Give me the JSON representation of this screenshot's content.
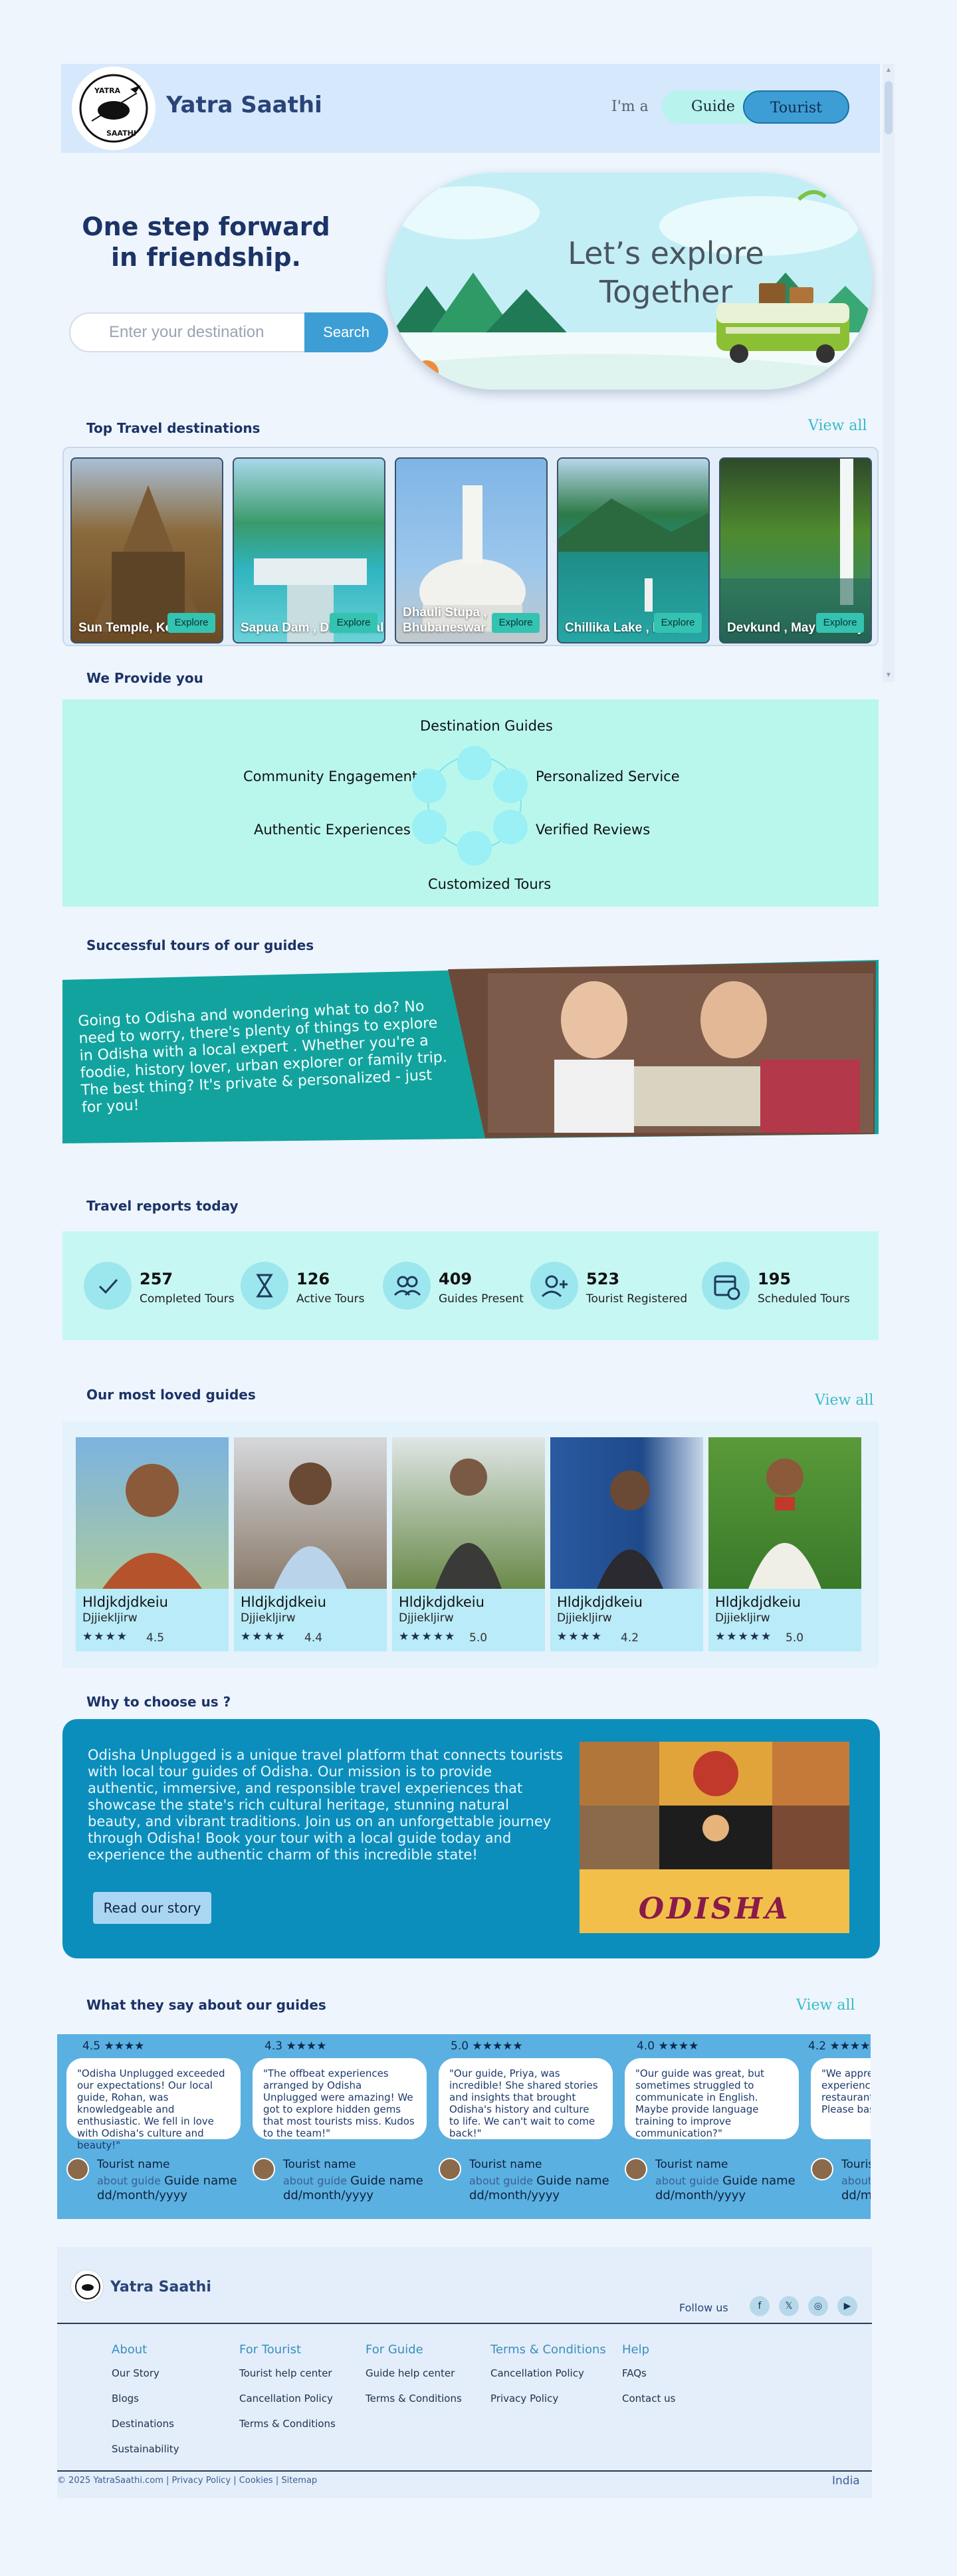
{
  "header": {
    "brand": "Yatra Saathi",
    "logo_text_top": "YATRA",
    "logo_text_bottom": "SAATHI",
    "role_prompt": "I'm a",
    "role_options": [
      "Guide",
      "Tourist"
    ],
    "selected_role": "Tourist"
  },
  "hero": {
    "title": "One step forward in friendship.",
    "search_placeholder": "Enter your destination",
    "search_button": "Search",
    "banner_text_line1": "Let’s explore",
    "banner_text_line2": "Together"
  },
  "destinations": {
    "heading": "Top Travel destinations",
    "view_all": "View all",
    "items": [
      {
        "name": "Sun Temple, Konark",
        "button": "Explore"
      },
      {
        "name": "Sapua Dam , Dhenkanal",
        "button": "Explore"
      },
      {
        "name": "Dhauli Stupa , Bhubaneswar",
        "button": "Explore"
      },
      {
        "name": "Chillika Lake , Puri",
        "button": "Explore"
      },
      {
        "name": "Devkund , Mayurbhanj",
        "button": "Explore"
      }
    ]
  },
  "provide": {
    "heading": "We Provide you",
    "items": [
      "Destination Guides",
      "Community Engagement",
      "Personalized Service",
      "Authentic Experiences",
      "Verified Reviews",
      "Customized Tours"
    ]
  },
  "tours": {
    "heading": "Successful tours of our guides",
    "text": "Going to Odisha and wondering what to do? No need to worry, there's plenty of things to explore in Odisha with a local expert . Whether you're a foodie, history lover, urban explorer or family trip. The best thing? It's private & personalized - just for you!"
  },
  "reports": {
    "heading": "Travel reports today",
    "stats": [
      {
        "value": "257",
        "label": "Completed Tours",
        "icon": "check-icon"
      },
      {
        "value": "126",
        "label": "Active Tours",
        "icon": "hourglass-icon"
      },
      {
        "value": "409",
        "label": "Guides Present",
        "icon": "users-icon"
      },
      {
        "value": "523",
        "label": "Tourist Registered",
        "icon": "user-add-icon"
      },
      {
        "value": "195",
        "label": "Scheduled Tours",
        "icon": "calendar-icon"
      }
    ]
  },
  "guides": {
    "heading": "Our most loved guides",
    "view_all": "View all",
    "items": [
      {
        "name": "Hldjkdjdkeiu",
        "sub": "Djjiekljirw",
        "stars": "★★★★",
        "rating": "4.5"
      },
      {
        "name": "Hldjkdjdkeiu",
        "sub": "Djjiekljirw",
        "stars": "★★★★",
        "rating": "4.4"
      },
      {
        "name": "Hldjkdjdkeiu",
        "sub": "Djjiekljirw",
        "stars": "★★★★★",
        "rating": "5.0"
      },
      {
        "name": "Hldjkdjdkeiu",
        "sub": "Djjiekljirw",
        "stars": "★★★★",
        "rating": "4.2"
      },
      {
        "name": "Hldjkdjdkeiu",
        "sub": "Djjiekljirw",
        "stars": "★★★★★",
        "rating": "5.0"
      }
    ]
  },
  "why": {
    "heading": "Why to choose us ?",
    "text": "Odisha Unplugged is a unique travel platform that connects tourists with local tour guides of Odisha. Our mission is to provide authentic, immersive, and responsible travel experiences that showcase the state's rich cultural heritage, stunning natural beauty, and vibrant traditions. Join us on an unforgettable journey through Odisha! Book your tour with a local guide today and experience the authentic charm of this incredible state!",
    "button": "Read our story",
    "image_caption": "ODISHA"
  },
  "testimonials": {
    "heading": "What they say about our guides",
    "view_all": "View all",
    "items": [
      {
        "rating": "4.5",
        "stars": "★★★★",
        "text": "\"Odisha Unplugged exceeded our expectations! Our local guide, Rohan, was knowledgeable and enthusiastic. We fell in love with Odisha's culture and beauty!\"",
        "name": "Tourist name",
        "about": "about guide",
        "guide": "Guide name",
        "date": "dd/month/yyyy"
      },
      {
        "rating": "4.3",
        "stars": "★★★★",
        "text": "\"The offbeat experiences arranged by Odisha Unplugged were amazing! We got to explore hidden gems that most tourists miss. Kudos to the team!\"",
        "name": "Tourist name",
        "about": "about guide",
        "guide": "Guide name",
        "date": "dd/month/yyyy"
      },
      {
        "rating": "5.0",
        "stars": "★★★★★",
        "text": "\"Our guide, Priya, was incredible! She shared stories and insights that brought Odisha's history and culture to life. We can't wait to come back!\"",
        "name": "Tourist name",
        "about": "about guide",
        "guide": "Guide name",
        "date": "dd/month/yyyy"
      },
      {
        "rating": "4.0",
        "stars": "★★★★",
        "text": "\"Our guide was great, but sometimes struggled to communicate in English. Maybe provide language training to improve communication?\"",
        "name": "Tourist name",
        "about": "about guide",
        "guide": "Guide name",
        "date": "dd/month/yyyy"
      },
      {
        "rating": "4.2",
        "stars": "★★★★",
        "text": "\"We appreciated the f experiences, but so t restaurants could be cleaner. Please bashyglene standar",
        "name": "Touris",
        "about": "about g",
        "guide": "",
        "date": "dd/m"
      }
    ]
  },
  "footer": {
    "brand": "Yatra Saathi",
    "follow": "Follow us",
    "social": [
      "facebook-icon",
      "x-icon",
      "instagram-icon",
      "youtube-icon"
    ],
    "columns": [
      {
        "title": "About",
        "items": [
          "Our Story",
          "Blogs",
          "Destinations",
          "Sustainability"
        ]
      },
      {
        "title": "For Tourist",
        "items": [
          "Tourist help center",
          "Cancellation Policy",
          "Terms & Conditions"
        ]
      },
      {
        "title": "For Guide",
        "items": [
          "Guide help center",
          "Terms & Conditions"
        ]
      },
      {
        "title": "Terms & Conditions",
        "items": [
          "Cancellation Policy",
          "Privacy Policy"
        ]
      },
      {
        "title": "Help",
        "items": [
          "FAQs",
          "Contact us"
        ]
      }
    ],
    "copyright": "© 2025 YatraSaathi.com | Privacy Policy | Cookies | Sitemap",
    "country": "India"
  }
}
